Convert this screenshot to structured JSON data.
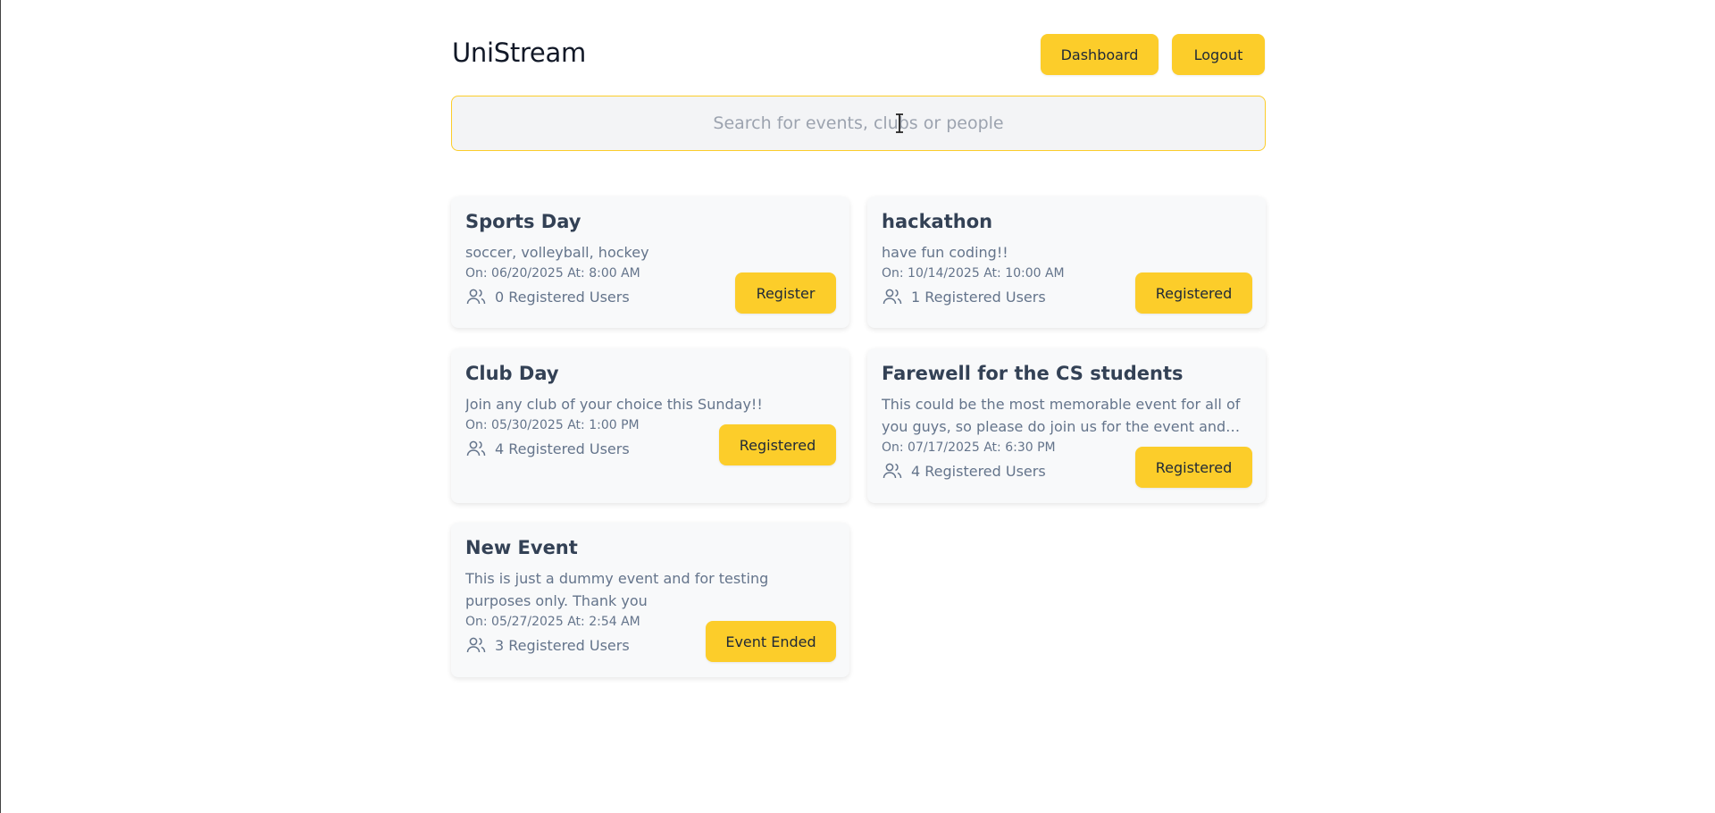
{
  "app": {
    "title": "UniStream"
  },
  "header": {
    "dashboard_label": "Dashboard",
    "logout_label": "Logout"
  },
  "search": {
    "placeholder": "Search for events, clubs or people",
    "value": ""
  },
  "events": [
    {
      "title": "Sports Day",
      "description": "soccer, volleyball, hockey",
      "date": "On: 06/20/2025 At: 8:00 AM",
      "users": "0 Registered Users",
      "button": "Register"
    },
    {
      "title": "hackathon",
      "description": "have fun coding!!",
      "date": "On: 10/14/2025 At: 10:00 AM",
      "users": "1 Registered Users",
      "button": "Registered"
    },
    {
      "title": "Club Day",
      "description": "Join any club of your choice this Sunday!!",
      "date": "On: 05/30/2025 At: 1:00 PM",
      "users": "4 Registered Users",
      "button": "Registered"
    },
    {
      "title": "Farewell for the CS students",
      "description": "This could be the most memorable event for all of you guys, so please do join us for the event and h...",
      "date": "On: 07/17/2025 At: 6:30 PM",
      "users": "4 Registered Users",
      "button": "Registered"
    },
    {
      "title": "New Event",
      "description": "This is just a dummy event and for testing purposes only. Thank you",
      "date": "On: 05/27/2025 At: 2:54 AM",
      "users": "3 Registered Users",
      "button": "Event Ended"
    }
  ],
  "colors": {
    "accent": "#fccd2a",
    "card_bg": "#f8f9fa",
    "search_bg": "#f3f4f6"
  },
  "icons": {
    "users": "users-icon",
    "cursor": "text-cursor-icon"
  }
}
